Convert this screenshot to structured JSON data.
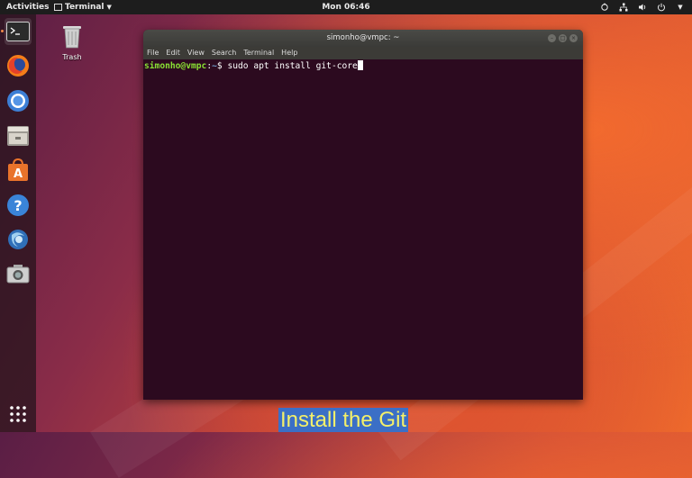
{
  "topbar": {
    "activities": "Activities",
    "app_menu": "Terminal",
    "clock": "Mon 06:46",
    "tray_icons": [
      "accessibility-icon",
      "network-icon",
      "volume-icon",
      "power-icon"
    ]
  },
  "dock": {
    "items": [
      {
        "name": "terminal-icon",
        "active": true
      },
      {
        "name": "firefox-icon"
      },
      {
        "name": "chromium-icon"
      },
      {
        "name": "files-icon"
      },
      {
        "name": "software-center-icon"
      },
      {
        "name": "help-icon"
      },
      {
        "name": "browser-app-icon"
      },
      {
        "name": "screenshot-icon"
      },
      {
        "name": "show-apps-icon"
      }
    ]
  },
  "desktop": {
    "trash_label": "Trash"
  },
  "terminal": {
    "title": "simonho@vmpc: ~",
    "menu": [
      "File",
      "Edit",
      "View",
      "Search",
      "Terminal",
      "Help"
    ],
    "prompt_user": "simonho@vmpc",
    "prompt_sep": ":",
    "prompt_path": "~",
    "prompt_symbol": "$ ",
    "command": "sudo apt install git-core"
  },
  "caption": "Install the Git",
  "colors": {
    "terminal_bg": "#2c0a1f",
    "prompt_user": "#8ae234",
    "prompt_path": "#729fcf",
    "caption_bg": "#3b6fc6",
    "caption_text": "#f4f06a"
  }
}
